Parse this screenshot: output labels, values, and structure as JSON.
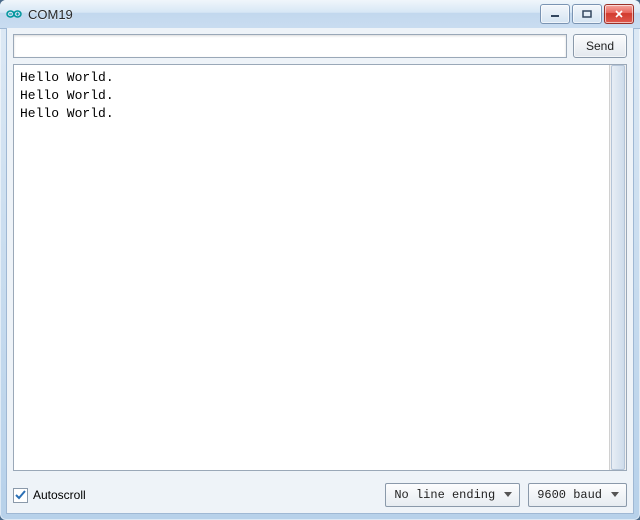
{
  "window": {
    "title": "COM19"
  },
  "top": {
    "input_value": "",
    "send_label": "Send"
  },
  "console": {
    "lines": [
      "Hello World.",
      "Hello World.",
      "Hello World."
    ]
  },
  "bottom": {
    "autoscroll_label": "Autoscroll",
    "autoscroll_checked": true,
    "line_ending_value": "No line ending",
    "baud_value": "9600 baud"
  }
}
